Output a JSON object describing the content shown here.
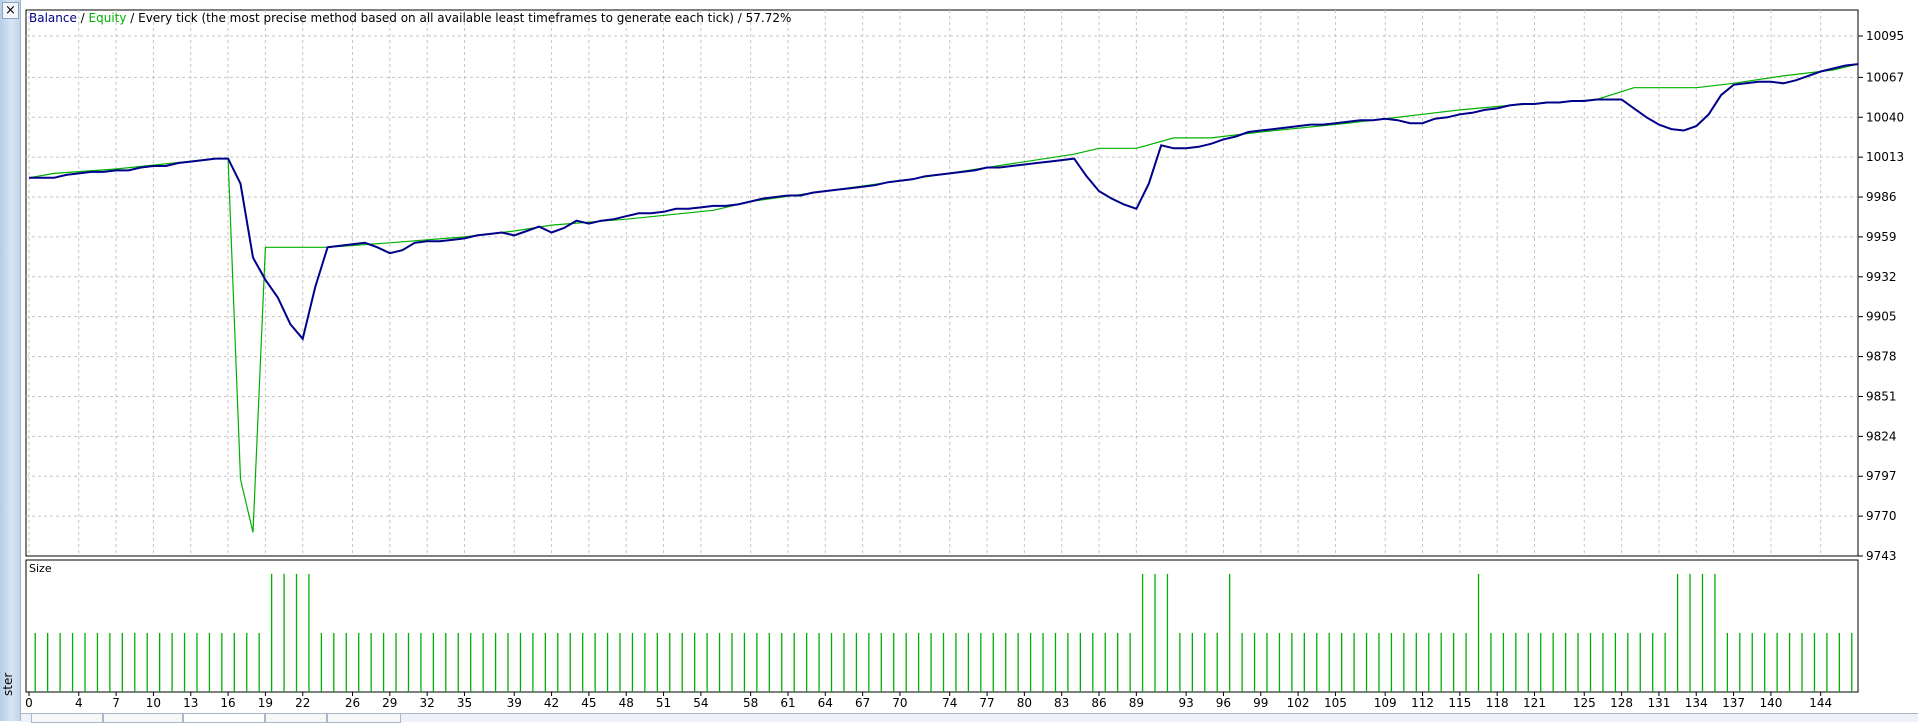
{
  "window": {
    "close_label": "×",
    "side_label": "ster"
  },
  "header": {
    "balance_label": "Balance",
    "sep1": " / ",
    "equity_label": "Equity",
    "rest": " / Every tick (the most precise method based on all available least timeframes to generate each tick) / 57.72%"
  },
  "size_panel": {
    "label": "Size"
  },
  "colors": {
    "balance": "#00008b",
    "equity": "#00b000",
    "grid": "#c6c6c6"
  },
  "chart_data": [
    {
      "type": "line",
      "title": "Balance / Equity / Every tick (the most precise method based on all available least timeframes to generate each tick) / 57.72%",
      "xlim": [
        0,
        147
      ],
      "ylim": [
        9743,
        10107
      ],
      "y_ticks": [
        10095,
        10067,
        10040,
        10013,
        9986,
        9959,
        9932,
        9905,
        9878,
        9851,
        9824,
        9797,
        9770,
        9743
      ],
      "x_ticks": [
        0,
        4,
        7,
        10,
        13,
        16,
        19,
        22,
        26,
        29,
        32,
        35,
        39,
        42,
        45,
        48,
        51,
        54,
        58,
        61,
        64,
        67,
        70,
        74,
        77,
        80,
        83,
        86,
        89,
        93,
        96,
        99,
        102,
        105,
        109,
        112,
        115,
        118,
        121,
        125,
        128,
        131,
        134,
        137,
        140,
        144
      ],
      "grid": true,
      "series": [
        {
          "name": "Balance",
          "x": [
            0,
            2,
            3,
            5,
            6,
            7,
            8,
            9,
            10,
            11,
            12,
            13,
            14,
            15,
            16,
            17,
            18,
            19,
            20,
            21,
            22,
            23,
            24,
            25,
            26,
            27,
            28,
            29,
            30,
            31,
            32,
            33,
            34,
            35,
            36,
            37,
            38,
            39,
            40,
            41,
            42,
            43,
            44,
            45,
            46,
            47,
            48,
            49,
            50,
            51,
            52,
            53,
            54,
            55,
            56,
            57,
            58,
            59,
            60,
            61,
            62,
            63,
            64,
            65,
            66,
            67,
            68,
            69,
            70,
            71,
            72,
            73,
            74,
            75,
            76,
            77,
            78,
            79,
            80,
            81,
            82,
            83,
            84,
            85,
            86,
            87,
            88,
            89,
            90,
            91,
            92,
            93,
            94,
            95,
            96,
            97,
            98,
            99,
            100,
            101,
            102,
            103,
            104,
            105,
            106,
            107,
            108,
            109,
            110,
            111,
            112,
            113,
            114,
            115,
            116,
            117,
            118,
            119,
            120,
            121,
            122,
            123,
            124,
            125,
            126,
            127,
            128,
            129,
            130,
            131,
            132,
            133,
            134,
            135,
            136,
            137,
            138,
            139,
            140,
            141,
            142,
            143,
            144,
            145,
            146,
            147
          ],
          "y": [
            9999,
            9999,
            10001,
            10003,
            10003,
            10004,
            10004,
            10006,
            10007,
            10007,
            10009,
            10010,
            10011,
            10012,
            10012,
            9995,
            9945,
            9930,
            9918,
            9900,
            9890,
            9925,
            9952,
            9953,
            9954,
            9955,
            9952,
            9948,
            9950,
            9955,
            9956,
            9956,
            9957,
            9958,
            9960,
            9961,
            9962,
            9960,
            9963,
            9966,
            9962,
            9965,
            9970,
            9968,
            9970,
            9971,
            9973,
            9975,
            9975,
            9976,
            9978,
            9978,
            9979,
            9980,
            9980,
            9981,
            9983,
            9985,
            9986,
            9987,
            9987,
            9989,
            9990,
            9991,
            9992,
            9993,
            9994,
            9996,
            9997,
            9998,
            10000,
            10001,
            10002,
            10003,
            10004,
            10006,
            10006,
            10007,
            10008,
            10009,
            10010,
            10011,
            10012,
            10000,
            9990,
            9985,
            9981,
            9978,
            9995,
            10021,
            10019,
            10019,
            10020,
            10022,
            10025,
            10027,
            10030,
            10031,
            10032,
            10033,
            10034,
            10035,
            10035,
            10036,
            10037,
            10038,
            10038,
            10039,
            10038,
            10036,
            10036,
            10039,
            10040,
            10042,
            10043,
            10045,
            10046,
            10048,
            10049,
            10049,
            10050,
            10050,
            10051,
            10051,
            10052,
            10052,
            10052,
            10046,
            10040,
            10035,
            10032,
            10031,
            10034,
            10042,
            10055,
            10062,
            10063,
            10064,
            10064,
            10063,
            10065,
            10068,
            10071,
            10073,
            10075,
            10076
          ]
        },
        {
          "name": "Equity",
          "x": [
            0,
            2,
            7,
            15,
            16,
            17,
            18,
            19,
            24,
            29,
            35,
            39,
            42,
            48,
            55,
            58,
            64,
            70,
            77,
            84,
            86,
            89,
            92,
            95,
            99,
            106,
            112,
            115,
            119,
            126,
            129,
            134,
            137,
            141,
            145,
            147
          ],
          "y": [
            9999,
            10002,
            10005,
            10012,
            10012,
            9795,
            9759,
            9952,
            9952,
            9955,
            9959,
            9963,
            9967,
            9971,
            9977,
            9983,
            9990,
            9997,
            10006,
            10015,
            10019,
            10019,
            10026,
            10026,
            10030,
            10036,
            10042,
            10045,
            10048,
            10052,
            10060,
            10060,
            10063,
            10068,
            10072,
            10076
          ]
        }
      ]
    },
    {
      "type": "bar",
      "title": "Size",
      "x": [
        0,
        1,
        2,
        3,
        4,
        5,
        6,
        7,
        8,
        9,
        10,
        11,
        12,
        13,
        14,
        15,
        16,
        17,
        18,
        19,
        20,
        21,
        22,
        23,
        24,
        25,
        26,
        27,
        28,
        29,
        30,
        31,
        32,
        33,
        34,
        35,
        36,
        37,
        38,
        39,
        40,
        41,
        42,
        43,
        44,
        45,
        46,
        47,
        48,
        49,
        50,
        51,
        52,
        53,
        54,
        55,
        56,
        57,
        58,
        59,
        60,
        61,
        62,
        63,
        64,
        65,
        66,
        67,
        68,
        69,
        70,
        71,
        72,
        73,
        74,
        75,
        76,
        77,
        78,
        79,
        80,
        81,
        82,
        83,
        84,
        85,
        86,
        87,
        88,
        89,
        90,
        91,
        92,
        93,
        94,
        95,
        96,
        97,
        98,
        99,
        100,
        101,
        102,
        103,
        104,
        105,
        106,
        107,
        108,
        109,
        110,
        111,
        112,
        113,
        114,
        115,
        116,
        117,
        118,
        119,
        120,
        121,
        122,
        123,
        124,
        125,
        126,
        127,
        128,
        129,
        130,
        131,
        132,
        133,
        134,
        135,
        136,
        137,
        138,
        139,
        140,
        141,
        142,
        143,
        144,
        145,
        146
      ],
      "values": [
        0.5,
        0.5,
        0.5,
        0.5,
        0.5,
        0.5,
        0.5,
        0.5,
        0.5,
        0.5,
        0.5,
        0.5,
        0.5,
        0.5,
        0.5,
        0.5,
        0.5,
        0.5,
        0.5,
        1,
        1,
        1,
        1,
        0.5,
        0.5,
        0.5,
        0.5,
        0.5,
        0.5,
        0.5,
        0.5,
        0.5,
        0.5,
        0.5,
        0.5,
        0.5,
        0.5,
        0.5,
        0.5,
        0.5,
        0.5,
        0.5,
        0.5,
        0.5,
        0.5,
        0.5,
        0.5,
        0.5,
        0.5,
        0.5,
        0.5,
        0.5,
        0.5,
        0.5,
        0.5,
        0.5,
        0.5,
        0.5,
        0.5,
        0.5,
        0.5,
        0.5,
        0.5,
        0.5,
        0.5,
        0.5,
        0.5,
        0.5,
        0.5,
        0.5,
        0.5,
        0.5,
        0.5,
        0.5,
        0.5,
        0.5,
        0.5,
        0.5,
        0.5,
        0.5,
        0.5,
        0.5,
        0.5,
        0.5,
        0.5,
        0.5,
        0.5,
        0.5,
        0.5,
        1,
        1,
        1,
        0.5,
        0.5,
        0.5,
        0.5,
        1,
        0.5,
        0.5,
        0.5,
        0.5,
        0.5,
        0.5,
        0.5,
        0.5,
        0.5,
        0.5,
        0.5,
        0.5,
        0.5,
        0.5,
        0.5,
        0.5,
        0.5,
        0.5,
        0.5,
        1,
        0.5,
        0.5,
        0.5,
        0.5,
        0.5,
        0.5,
        0.5,
        0.5,
        0.5,
        0.5,
        0.5,
        0.5,
        0.5,
        0.5,
        0.5,
        1,
        1,
        1,
        1,
        0.5,
        0.5,
        0.5,
        0.5,
        0.5,
        0.5,
        0.5,
        0.5,
        0.5,
        0.5,
        0.5
      ],
      "ylim": [
        0,
        1.05
      ]
    }
  ]
}
